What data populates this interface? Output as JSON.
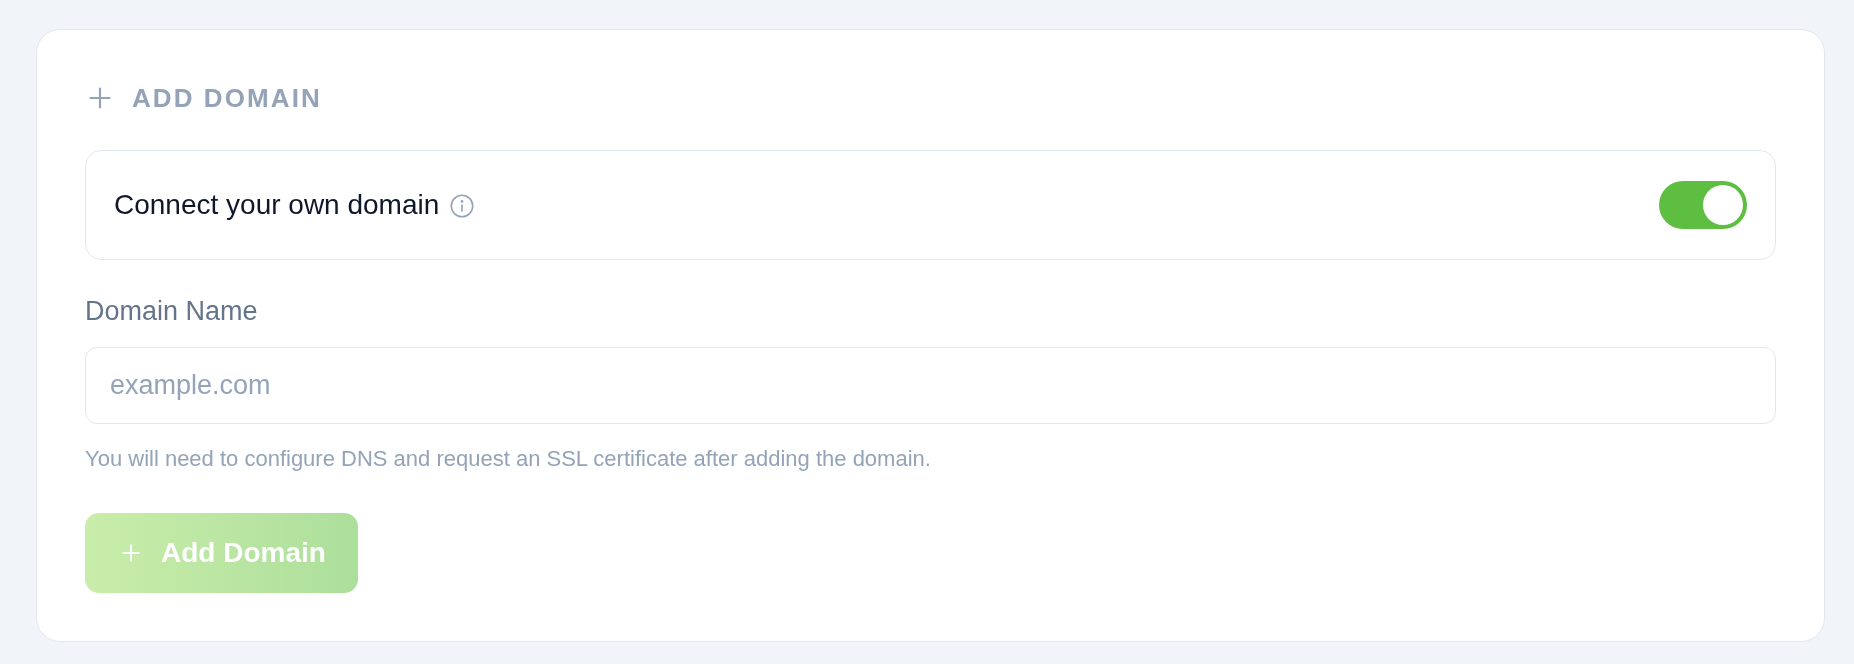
{
  "section": {
    "title": "ADD DOMAIN"
  },
  "connect_toggle": {
    "label": "Connect your own domain",
    "on": true
  },
  "domain_field": {
    "label": "Domain Name",
    "placeholder": "example.com",
    "help": "You will need to configure DNS and request an SSL certificate after adding the domain."
  },
  "add_button": {
    "label": "Add Domain",
    "disabled": true
  }
}
